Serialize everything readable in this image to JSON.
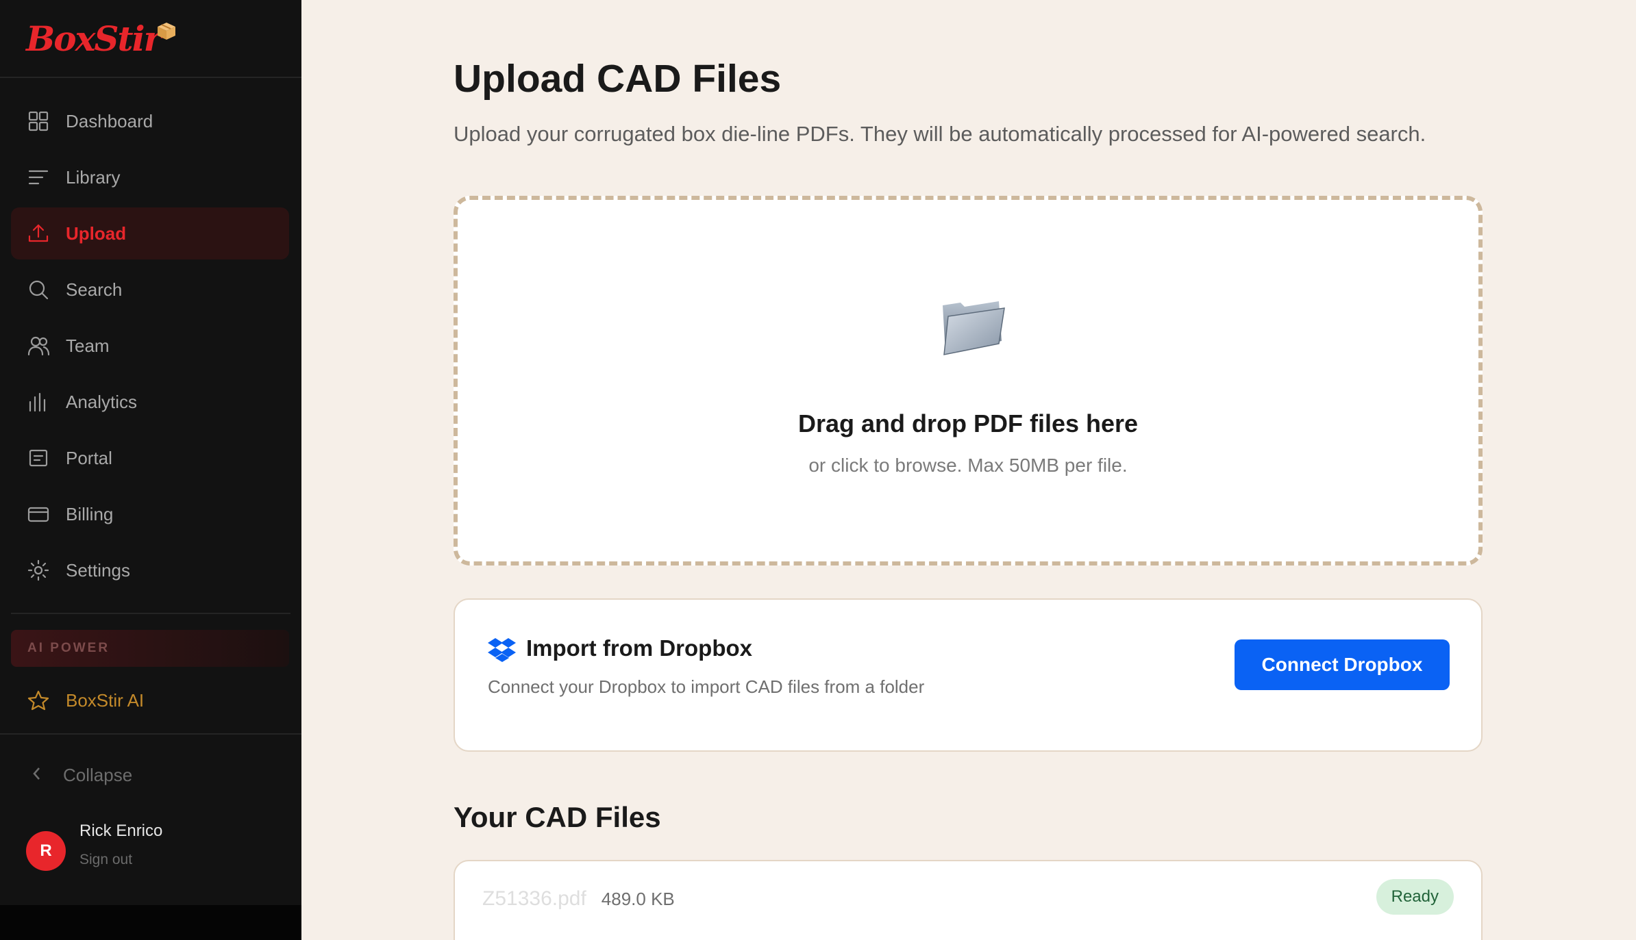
{
  "app": {
    "brand": "BoxStir",
    "accent_color": "#e8262b"
  },
  "sidebar": {
    "items": [
      {
        "label": "Dashboard",
        "icon": "grid-icon"
      },
      {
        "label": "Library",
        "icon": "list-icon"
      },
      {
        "label": "Upload",
        "icon": "upload-icon",
        "active": true
      },
      {
        "label": "Search",
        "icon": "search-icon"
      },
      {
        "label": "Team",
        "icon": "users-icon"
      },
      {
        "label": "Analytics",
        "icon": "bar-chart-icon"
      },
      {
        "label": "Portal",
        "icon": "portal-icon"
      },
      {
        "label": "Billing",
        "icon": "credit-card-icon"
      },
      {
        "label": "Settings",
        "icon": "gear-icon"
      }
    ],
    "ai_section_label": "AI POWER",
    "ai_item": {
      "label": "BoxStir AI",
      "icon": "star-icon"
    },
    "collapse_label": "Collapse",
    "user": {
      "initial": "R",
      "name": "Rick Enrico",
      "sign_out": "Sign out"
    }
  },
  "main": {
    "title": "Upload CAD Files",
    "subtitle": "Upload your corrugated box die-line PDFs. They will be automatically processed for AI-powered search.",
    "dropzone": {
      "icon": "folder-icon",
      "title": "Drag and drop PDF files here",
      "subtitle": "or click to browse. Max 50MB per file."
    },
    "dropbox": {
      "icon": "dropbox-icon",
      "title": "Import from Dropbox",
      "subtitle": "Connect your Dropbox to import CAD files from a folder",
      "button_label": "Connect Dropbox",
      "button_color": "#0a62f4"
    },
    "files_section_title": "Your CAD Files",
    "files": [
      {
        "name": "Z51336.pdf",
        "size": "489.0 KB",
        "status": "Ready"
      }
    ]
  }
}
